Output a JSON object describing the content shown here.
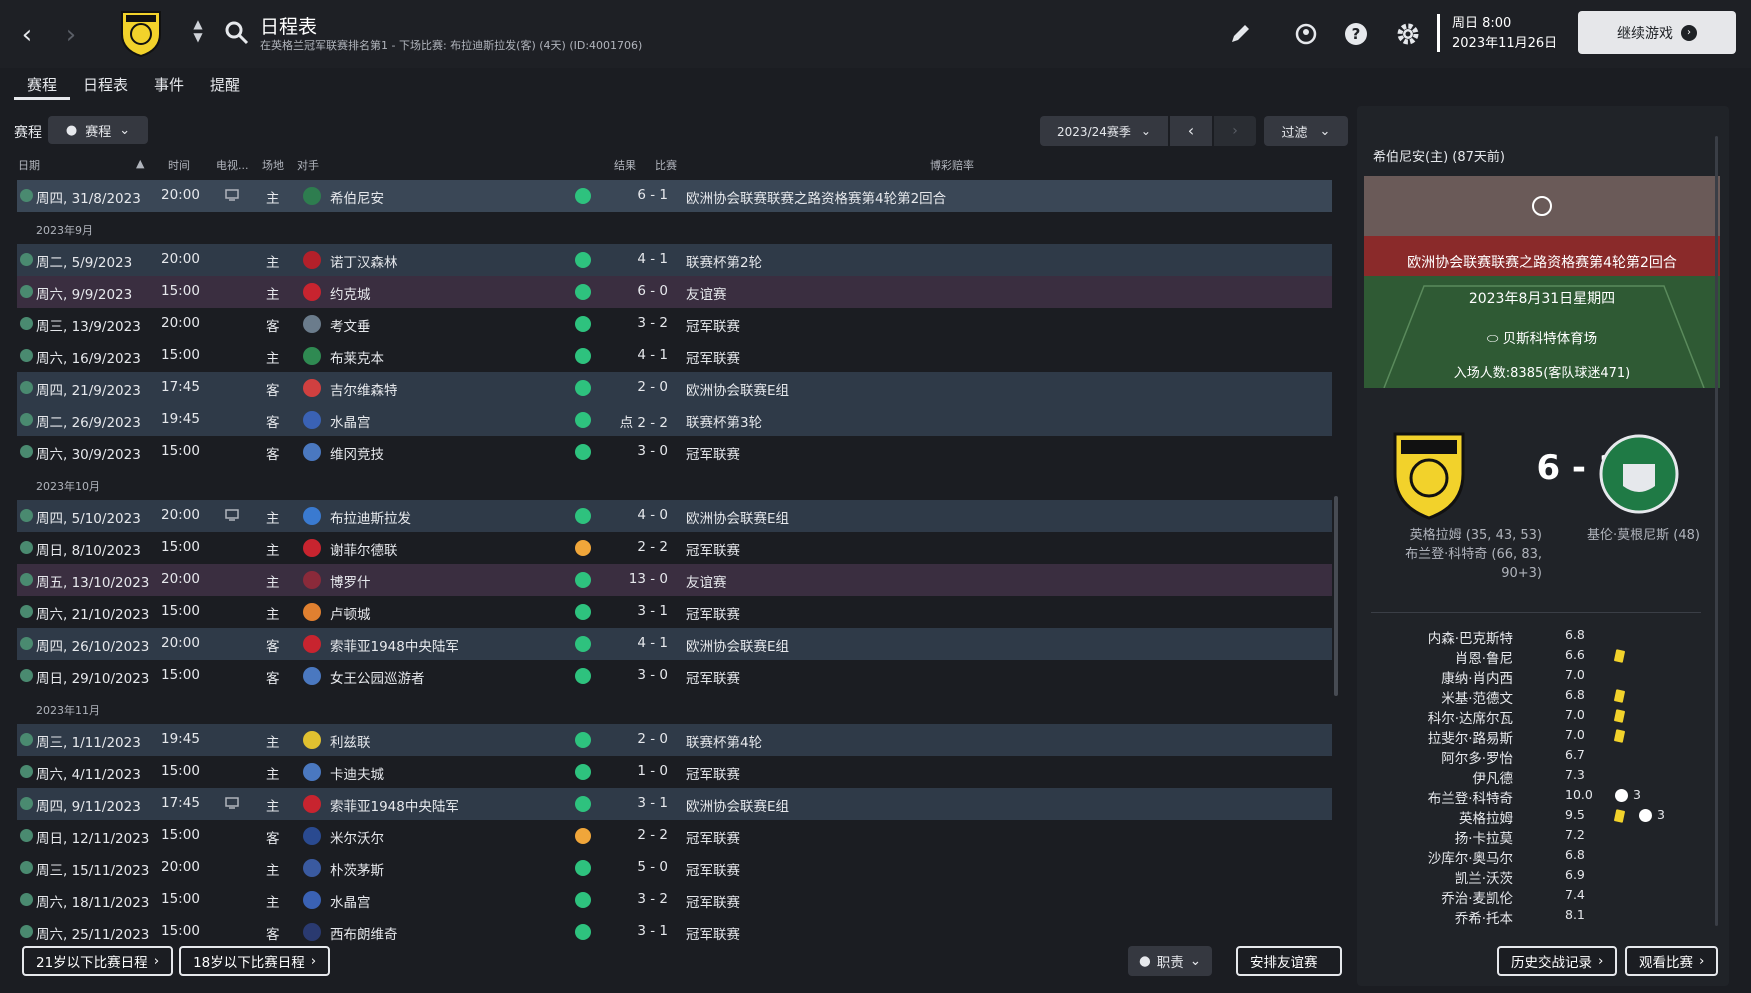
{
  "header": {
    "title": "日程表",
    "subtitle": "在英格兰冠军联赛排名第1 - 下场比赛: 布拉迪斯拉发(客) (4天) (ID:4001706)",
    "datetime_line1": "周日 8:00",
    "datetime_line2": "2023年11月26日",
    "continue_label": "继续游戏"
  },
  "tabs": [
    "赛程",
    "日程表",
    "事件",
    "提醒"
  ],
  "filters": {
    "label": "赛程",
    "view_label": "赛程",
    "season_label": "2023/24赛季",
    "filter_label": "过滤"
  },
  "columns": {
    "date": "日期",
    "time": "时间",
    "tv": "电视...",
    "venue": "场地",
    "opponent": "对手",
    "result": "结果",
    "competition": "比赛",
    "odds": "博彩赔率"
  },
  "rows": [
    {
      "type": "match",
      "hl": "sel",
      "date": "周四, 31/8/2023",
      "time": "20:00",
      "tv": true,
      "venue": "主",
      "opponent": "希伯尼安",
      "logo": "#2e7d4f",
      "res": "win",
      "score": "6 - 1",
      "comp": "欧洲协会联赛联赛之路资格赛第4轮第2回合"
    },
    {
      "type": "month",
      "label": "2023年9月"
    },
    {
      "type": "match",
      "hl": "blue",
      "date": "周二, 5/9/2023",
      "time": "20:00",
      "tv": false,
      "venue": "主",
      "opponent": "诺丁汉森林",
      "logo": "#b3202a",
      "res": "win",
      "score": "4 - 1",
      "comp": "联赛杯第2轮"
    },
    {
      "type": "match",
      "hl": "purple",
      "date": "周六, 9/9/2023",
      "time": "15:00",
      "tv": false,
      "venue": "主",
      "opponent": "约克城",
      "logo": "#c8242f",
      "res": "win",
      "score": "6 - 0",
      "comp": "友谊赛"
    },
    {
      "type": "match",
      "hl": "",
      "date": "周三, 13/9/2023",
      "time": "20:00",
      "tv": false,
      "venue": "客",
      "opponent": "考文垂",
      "logo": "#6b7c8c",
      "res": "win",
      "score": "3 - 2",
      "comp": "冠军联赛"
    },
    {
      "type": "match",
      "hl": "",
      "date": "周六, 16/9/2023",
      "time": "15:00",
      "tv": false,
      "venue": "主",
      "opponent": "布莱克本",
      "logo": "#2f8a52",
      "res": "win",
      "score": "4 - 1",
      "comp": "冠军联赛"
    },
    {
      "type": "match",
      "hl": "blue",
      "date": "周四, 21/9/2023",
      "time": "17:45",
      "tv": false,
      "venue": "客",
      "opponent": "吉尔维森特",
      "logo": "#d04040",
      "res": "win",
      "score": "2 - 0",
      "comp": "欧洲协会联赛E组"
    },
    {
      "type": "match",
      "hl": "blue",
      "date": "周二, 26/9/2023",
      "time": "19:45",
      "tv": false,
      "venue": "客",
      "opponent": "水晶宫",
      "logo": "#3a62b5",
      "res": "win",
      "score": "点 2 - 2",
      "comp": "联赛杯第3轮"
    },
    {
      "type": "match",
      "hl": "",
      "date": "周六, 30/9/2023",
      "time": "15:00",
      "tv": false,
      "venue": "客",
      "opponent": "维冈竞技",
      "logo": "#4a78c0",
      "res": "win",
      "score": "3 - 0",
      "comp": "冠军联赛"
    },
    {
      "type": "month",
      "label": "2023年10月"
    },
    {
      "type": "match",
      "hl": "blue",
      "date": "周四, 5/10/2023",
      "time": "20:00",
      "tv": true,
      "venue": "主",
      "opponent": "布拉迪斯拉发",
      "logo": "#3a7ad0",
      "res": "win",
      "score": "4 - 0",
      "comp": "欧洲协会联赛E组"
    },
    {
      "type": "match",
      "hl": "",
      "date": "周日, 8/10/2023",
      "time": "15:00",
      "tv": false,
      "venue": "主",
      "opponent": "谢菲尔德联",
      "logo": "#c8242f",
      "res": "draw",
      "score": "2 - 2",
      "comp": "冠军联赛"
    },
    {
      "type": "match",
      "hl": "purple",
      "date": "周五, 13/10/2023",
      "time": "20:00",
      "tv": false,
      "venue": "主",
      "opponent": "博罗什",
      "logo": "#8a2a3a",
      "res": "win",
      "score": "13 - 0",
      "comp": "友谊赛"
    },
    {
      "type": "match",
      "hl": "",
      "date": "周六, 21/10/2023",
      "time": "15:00",
      "tv": false,
      "venue": "主",
      "opponent": "卢顿城",
      "logo": "#e08030",
      "res": "win",
      "score": "3 - 1",
      "comp": "冠军联赛"
    },
    {
      "type": "match",
      "hl": "blue",
      "date": "周四, 26/10/2023",
      "time": "20:00",
      "tv": false,
      "venue": "客",
      "opponent": "索菲亚1948中央陆军",
      "logo": "#c8242f",
      "res": "win",
      "score": "4 - 1",
      "comp": "欧洲协会联赛E组"
    },
    {
      "type": "match",
      "hl": "",
      "date": "周日, 29/10/2023",
      "time": "15:00",
      "tv": false,
      "venue": "客",
      "opponent": "女王公园巡游者",
      "logo": "#4a78c0",
      "res": "win",
      "score": "3 - 0",
      "comp": "冠军联赛"
    },
    {
      "type": "month",
      "label": "2023年11月"
    },
    {
      "type": "match",
      "hl": "blue",
      "date": "周三, 1/11/2023",
      "time": "19:45",
      "tv": false,
      "venue": "主",
      "opponent": "利兹联",
      "logo": "#e0c030",
      "res": "win",
      "score": "2 - 0",
      "comp": "联赛杯第4轮"
    },
    {
      "type": "match",
      "hl": "",
      "date": "周六, 4/11/2023",
      "time": "15:00",
      "tv": false,
      "venue": "主",
      "opponent": "卡迪夫城",
      "logo": "#4a78c0",
      "res": "win",
      "score": "1 - 0",
      "comp": "冠军联赛"
    },
    {
      "type": "match",
      "hl": "blue",
      "date": "周四, 9/11/2023",
      "time": "17:45",
      "tv": true,
      "venue": "主",
      "opponent": "索菲亚1948中央陆军",
      "logo": "#c8242f",
      "res": "win",
      "score": "3 - 1",
      "comp": "欧洲协会联赛E组"
    },
    {
      "type": "match",
      "hl": "",
      "date": "周日, 12/11/2023",
      "time": "15:00",
      "tv": false,
      "venue": "客",
      "opponent": "米尔沃尔",
      "logo": "#2a4a90",
      "res": "draw",
      "score": "2 - 2",
      "comp": "冠军联赛"
    },
    {
      "type": "match",
      "hl": "",
      "date": "周三, 15/11/2023",
      "time": "20:00",
      "tv": false,
      "venue": "主",
      "opponent": "朴茨茅斯",
      "logo": "#3a5aa0",
      "res": "win",
      "score": "5 - 0",
      "comp": "冠军联赛"
    },
    {
      "type": "match",
      "hl": "",
      "date": "周六, 18/11/2023",
      "time": "15:00",
      "tv": false,
      "venue": "主",
      "opponent": "水晶宫",
      "logo": "#3a62b5",
      "res": "win",
      "score": "3 - 2",
      "comp": "冠军联赛"
    },
    {
      "type": "match",
      "hl": "",
      "date": "周六, 25/11/2023",
      "time": "15:00",
      "tv": false,
      "venue": "客",
      "opponent": "西布朗维奇",
      "logo": "#2a3a70",
      "res": "win",
      "score": "3 - 1",
      "comp": "冠军联赛"
    }
  ],
  "bottom": {
    "u21_label": "21岁以下比赛日程",
    "u18_label": "18岁以下比赛日程",
    "duty_label": "职责",
    "friendly_label": "安排友谊赛"
  },
  "side": {
    "title": "希伯尼安(主) (87天前)",
    "competition": "欧洲协会联赛联赛之路资格赛第4轮第2回合",
    "match_date": "2023年8月31日星期四",
    "stadium": "贝斯科特体育场",
    "attendance": "入场人数:8385(客队球迷471)",
    "score": "6 - 1",
    "home_scorers": [
      "英格拉姆 (35, 43, 53)",
      "布兰登·科特奇 (66, 83,",
      "90+3)"
    ],
    "away_scorers": [
      "基伦·莫根尼斯 (48)"
    ],
    "players": [
      {
        "name": "内森·巴克斯特",
        "rating": "6.8",
        "yellow": false,
        "goals": ""
      },
      {
        "name": "肖恩·鲁尼",
        "rating": "6.6",
        "yellow": true,
        "goals": ""
      },
      {
        "name": "康纳·肖内西",
        "rating": "7.0",
        "yellow": false,
        "goals": ""
      },
      {
        "name": "米基·范德文",
        "rating": "6.8",
        "yellow": true,
        "goals": ""
      },
      {
        "name": "科尔·达席尔瓦",
        "rating": "7.0",
        "yellow": true,
        "goals": ""
      },
      {
        "name": "拉斐尔·路易斯",
        "rating": "7.0",
        "yellow": true,
        "goals": ""
      },
      {
        "name": "阿尔多·罗怡",
        "rating": "6.7",
        "yellow": false,
        "goals": ""
      },
      {
        "name": "伊凡德",
        "rating": "7.3",
        "yellow": false,
        "goals": ""
      },
      {
        "name": "布兰登·科特奇",
        "rating": "10.0",
        "yellow": false,
        "goals": "3"
      },
      {
        "name": "英格拉姆",
        "rating": "9.5",
        "yellow": true,
        "goals": "3"
      },
      {
        "name": "扬·卡拉莫",
        "rating": "7.2",
        "yellow": false,
        "goals": ""
      },
      {
        "name": "沙库尔·奥马尔",
        "rating": "6.8",
        "yellow": false,
        "goals": ""
      },
      {
        "name": "凯兰·沃茨",
        "rating": "6.9",
        "yellow": false,
        "goals": ""
      },
      {
        "name": "乔治·麦凯伦",
        "rating": "7.4",
        "yellow": false,
        "goals": ""
      },
      {
        "name": "乔希·托本",
        "rating": "8.1",
        "yellow": false,
        "goals": ""
      }
    ],
    "h2h_label": "历史交战记录",
    "watch_label": "观看比赛"
  }
}
